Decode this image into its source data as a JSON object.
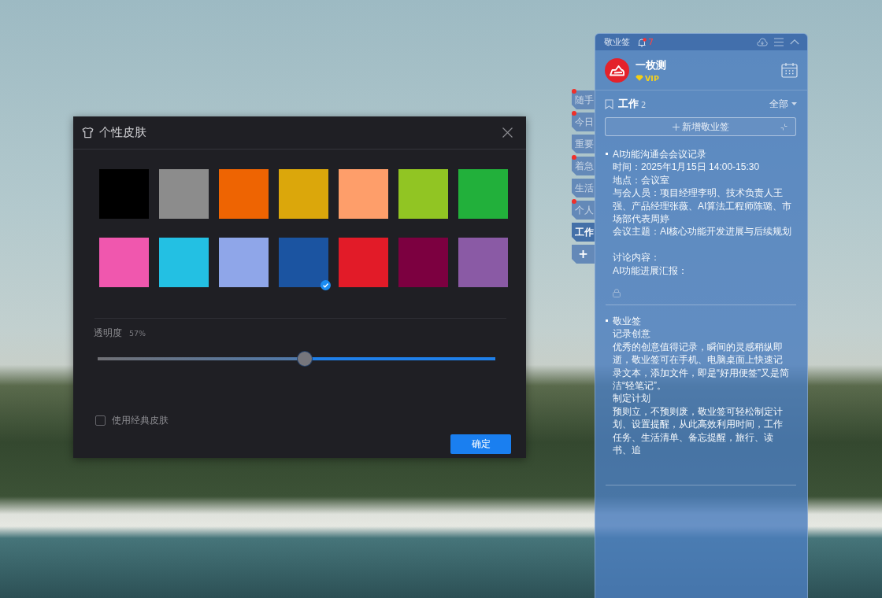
{
  "skin_dialog": {
    "title": "个性皮肤",
    "swatches": [
      {
        "color": "#000000",
        "selected": false
      },
      {
        "color": "#8c8c8c",
        "selected": false
      },
      {
        "color": "#ee6402",
        "selected": false
      },
      {
        "color": "#dba70b",
        "selected": false
      },
      {
        "color": "#fe9e6a",
        "selected": false
      },
      {
        "color": "#91c523",
        "selected": false
      },
      {
        "color": "#22b03b",
        "selected": false
      },
      {
        "color": "#f057ae",
        "selected": false
      },
      {
        "color": "#23c0e3",
        "selected": false
      },
      {
        "color": "#8fa6e9",
        "selected": false
      },
      {
        "color": "#1b54a1",
        "selected": true
      },
      {
        "color": "#e21b28",
        "selected": false
      },
      {
        "color": "#7c0040",
        "selected": false
      },
      {
        "color": "#8a5aa5",
        "selected": false
      }
    ],
    "opacity": {
      "label": "透明度",
      "reading": "57%",
      "level": 0.52
    },
    "classic_skin": {
      "label": "使用经典皮肤",
      "checked": false
    },
    "confirm_button": "确定"
  },
  "side_tabs": [
    {
      "label": "随手",
      "kind": "category",
      "unread": true,
      "selected": false
    },
    {
      "label": "今日",
      "kind": "category",
      "unread": true,
      "selected": false
    },
    {
      "label": "重要",
      "kind": "category",
      "unread": false,
      "selected": false
    },
    {
      "label": "着急",
      "kind": "category",
      "unread": true,
      "selected": false
    },
    {
      "label": "生活",
      "kind": "category",
      "unread": false,
      "selected": false
    },
    {
      "label": "个人",
      "kind": "category",
      "unread": true,
      "selected": false
    },
    {
      "label": "工作",
      "kind": "category",
      "unread": false,
      "selected": true
    },
    {
      "label": "+",
      "kind": "add",
      "unread": false,
      "selected": false
    }
  ],
  "notes_panel": {
    "title": "敬业签",
    "notification_count": "7",
    "user": {
      "name": "一枚测",
      "badge": "VIP"
    },
    "category": {
      "name": "工作",
      "count": "2",
      "filter": "全部"
    },
    "new_button": "新增敬业签",
    "notes": [
      {
        "locked": true,
        "blocks": [
          [
            "AI功能沟通会会议记录",
            "时间：2025年1月15日 14:00-15:30",
            "地点：会议室",
            "与会人员：项目经理李明、技术负责人王强、产品经理张薇、AI算法工程师陈璐、市场部代表周婷",
            "会议主题：AI核心功能开发进展与后续规划"
          ],
          [
            "讨论内容：",
            "AI功能进展汇报："
          ]
        ]
      },
      {
        "locked": false,
        "blocks": [
          [
            "敬业签",
            "记录创意",
            "优秀的创意值得记录，瞬间的灵感稍纵即逝，敬业签可在手机、电脑桌面上快速记录文本，添加文件，即是“好用便签”又是简洁“轻笔记”。",
            "制定计划",
            "预则立，不预则废，敬业签可轻松制定计划、设置提醒，从此高效利用时间，工作任务、生活清单、备忘提醒，旅行、读书、追"
          ]
        ]
      }
    ]
  }
}
